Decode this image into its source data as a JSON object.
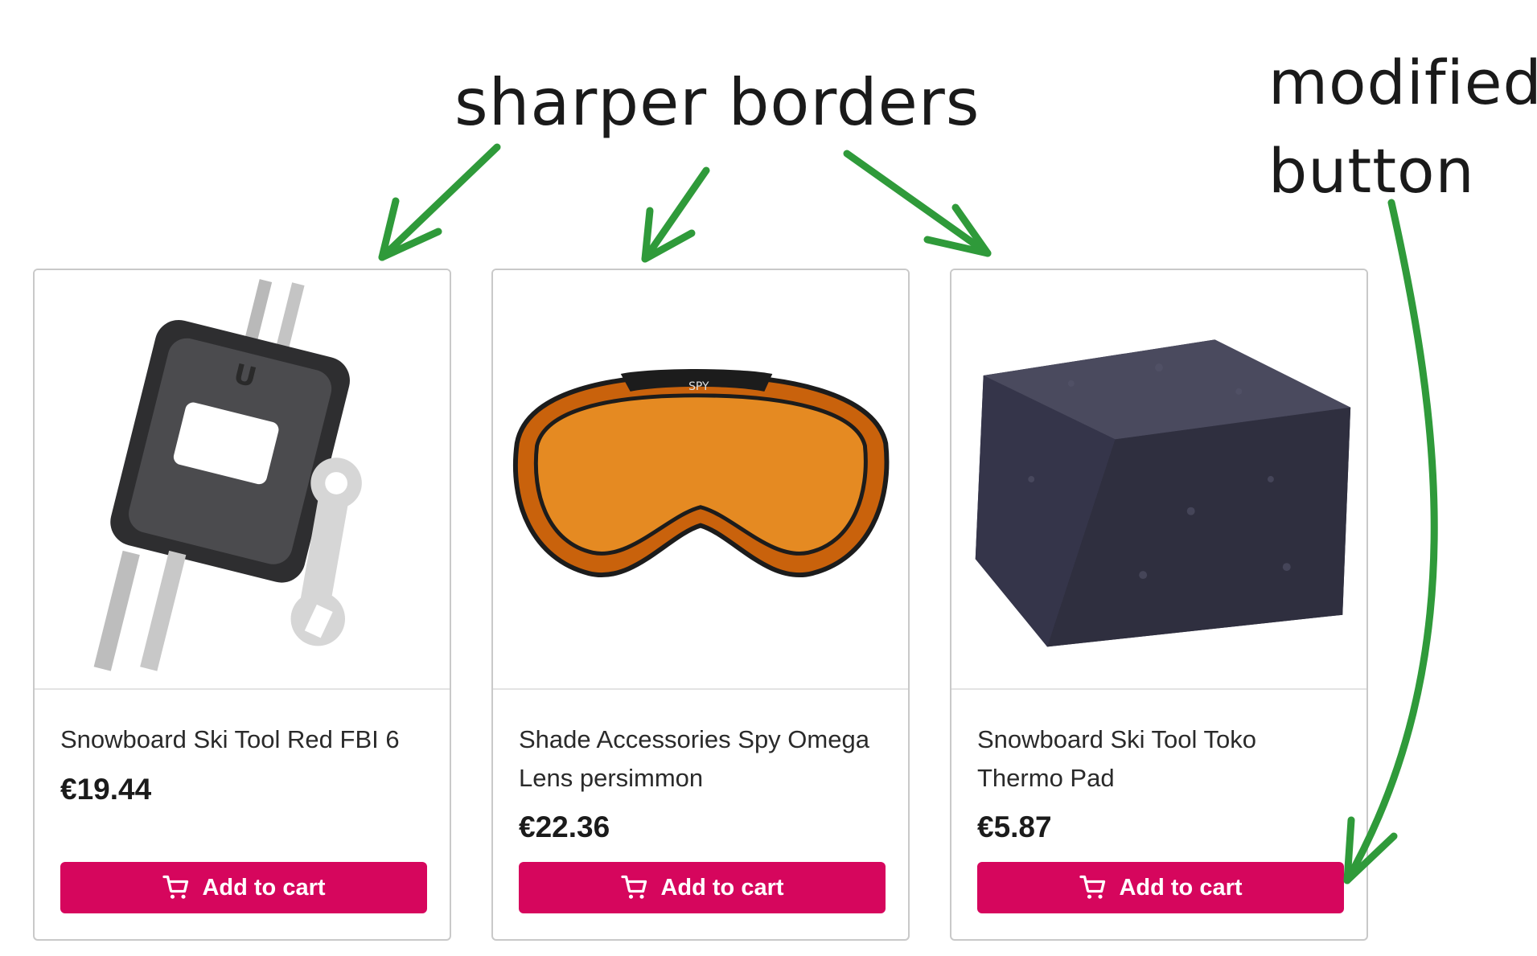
{
  "annotations": {
    "sharper_borders": "sharper borders",
    "modified_line1": "modified",
    "modified_line2": "button"
  },
  "colors": {
    "accent": "#d6065d",
    "arrow": "#2f9a3a",
    "card_border": "#c9c9c9"
  },
  "products": [
    {
      "title": "Snowboard Ski Tool Red FBI 6",
      "price": "€19.44",
      "button": "Add to cart",
      "image_icon": "snowboard-tool-icon"
    },
    {
      "title": "Shade Accessories Spy Omega Lens persimmon",
      "price": "€22.36",
      "button": "Add to cart",
      "image_icon": "goggle-lens-icon"
    },
    {
      "title": "Snowboard Ski Tool Toko Thermo Pad",
      "price": "€5.87",
      "button": "Add to cart",
      "image_icon": "thermo-pad-icon"
    }
  ]
}
